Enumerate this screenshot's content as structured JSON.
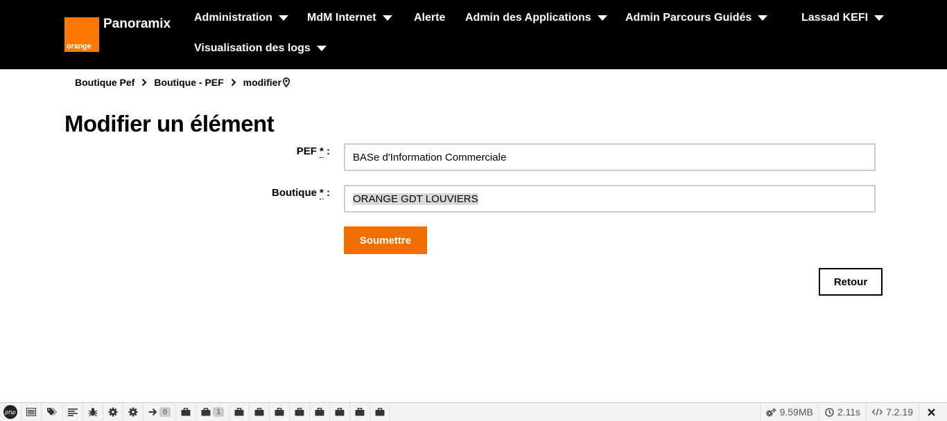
{
  "header": {
    "logo_text": "orange",
    "brand": "Panoramix",
    "nav": [
      {
        "label": "Administration",
        "dropdown": true
      },
      {
        "label": "MdM Internet",
        "dropdown": true
      },
      {
        "label": "Alerte",
        "dropdown": false
      },
      {
        "label": "Admin des Applications",
        "dropdown": true
      },
      {
        "label": "Admin Parcours Guidés",
        "dropdown": true
      },
      {
        "label": "Lassad KEFI",
        "dropdown": true
      },
      {
        "label": "Visualisation des logs",
        "dropdown": true
      }
    ]
  },
  "breadcrumb": {
    "items": [
      "Boutique Pef",
      "Boutique - PEF"
    ],
    "current": "modifier"
  },
  "page": {
    "title": "Modifier un élément"
  },
  "form": {
    "pef": {
      "label": "PEF",
      "required_mark": "*",
      "value": "BASe d'Information Commerciale"
    },
    "boutique": {
      "label": "Boutique",
      "required_mark": "*",
      "value": "ORANGE GDT LOUVIERS"
    },
    "submit_label": "Soumettre",
    "back_label": "Retour"
  },
  "toolbar": {
    "logo": "php",
    "route_badge": "6",
    "collection_badge": "1",
    "memory": "9.59MB",
    "time": "2.11s",
    "php_version": "7.2.19"
  },
  "colors": {
    "header_bg": "#000000",
    "brand_orange": "#ff7900",
    "submit_bg": "#f16e00"
  }
}
